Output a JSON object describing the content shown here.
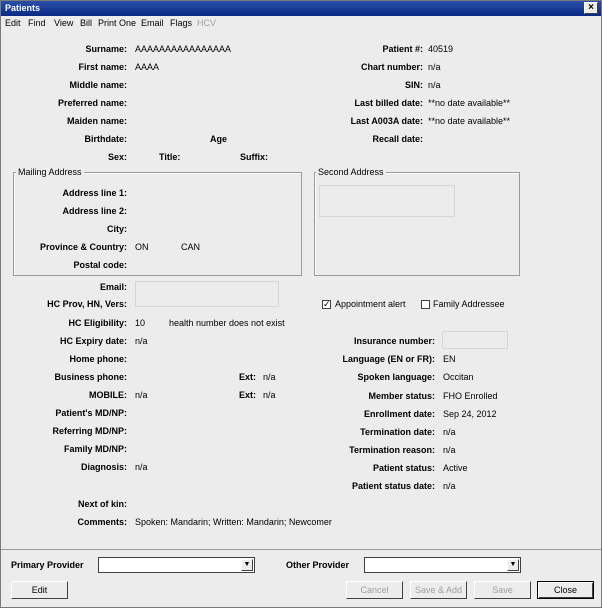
{
  "window": {
    "title": "Patients",
    "close_glyph": "×"
  },
  "menu": [
    "Edit",
    "Find",
    "View",
    "Bill",
    "Print One",
    "Email",
    "Flags",
    "HCV"
  ],
  "left": {
    "surname_label": "Surname:",
    "surname": "AAAAAAAAAAAAAAAA",
    "firstname_label": "First name:",
    "firstname": "AAAA",
    "middlename_label": "Middle name:",
    "preferred_label": "Preferred name:",
    "maiden_label": "Maiden name:",
    "birthdate_label": "Birthdate:",
    "age_label": "Age",
    "sex_label": "Sex:",
    "title_label": "Title:",
    "suffix_label": "Suffix:"
  },
  "right": {
    "patientnum_label": "Patient #:",
    "patientnum": "40519",
    "chart_label": "Chart number:",
    "chart": "n/a",
    "sin_label": "SIN:",
    "sin": "n/a",
    "lastbilled_label": "Last billed date:",
    "lastbilled": "**no date available**",
    "lasta003a_label": "Last A003A date:",
    "lasta003a": "**no date available**",
    "recall_label": "Recall date:"
  },
  "mailing": {
    "title": "Mailing Address",
    "addr1_label": "Address line 1:",
    "addr2_label": "Address line 2:",
    "city_label": "City:",
    "province_label": "Province & Country:",
    "province": "ON",
    "country": "CAN",
    "postal_label": "Postal code:"
  },
  "second": {
    "title": "Second Address"
  },
  "contact": {
    "email_label": "Email:",
    "hcprov_label": "HC Prov, HN, Vers:",
    "appt_alert_label": "Appointment alert",
    "appt_alert_checked": true,
    "check_glyph": "✓",
    "family_addr_label": "Family Addressee",
    "hcelig_label": "HC Eligibility:",
    "hcelig": "10",
    "hcelig_msg": "health number does not exist",
    "hcexpiry_label": "HC Expiry date:",
    "hcexpiry": "n/a",
    "insurance_label": "Insurance number:",
    "homephone_label": "Home phone:",
    "language_label": "Language (EN or FR):",
    "language": "EN",
    "bizphone_label": "Business phone:",
    "ext_label": "Ext:",
    "bizext": "n/a",
    "spoken_label": "Spoken language:",
    "spoken": "Occitan",
    "mobile_label": "MOBILE:",
    "mobile": "n/a",
    "mobileext": "n/a",
    "member_label": "Member status:",
    "member": "FHO Enrolled",
    "patientmd_label": "Patient's MD/NP:",
    "enroll_label": "Enrollment date:",
    "enroll": "Sep 24, 2012",
    "referring_label": "Referring MD/NP:",
    "termdate_label": "Termination date:",
    "termdate": "n/a",
    "familymd_label": "Family MD/NP:",
    "termreason_label": "Termination reason:",
    "termreason": "n/a",
    "diagnosis_label": "Diagnosis:",
    "diagnosis": "n/a",
    "patstatus_label": "Patient status:",
    "patstatus": "Active",
    "patstatusdate_label": "Patient status date:",
    "patstatusdate": "n/a",
    "nextofkin_label": "Next of kin:",
    "comments_label": "Comments:",
    "comments": "Spoken: Mandarin; Written: Mandarin; Newcomer"
  },
  "footer": {
    "primary_label": "Primary Provider",
    "other_label": "Other Provider",
    "dropdown_glyph": "▼",
    "edit": "Edit",
    "cancel": "Cancel",
    "saveadd": "Save & Add",
    "save": "Save",
    "close": "Close"
  }
}
